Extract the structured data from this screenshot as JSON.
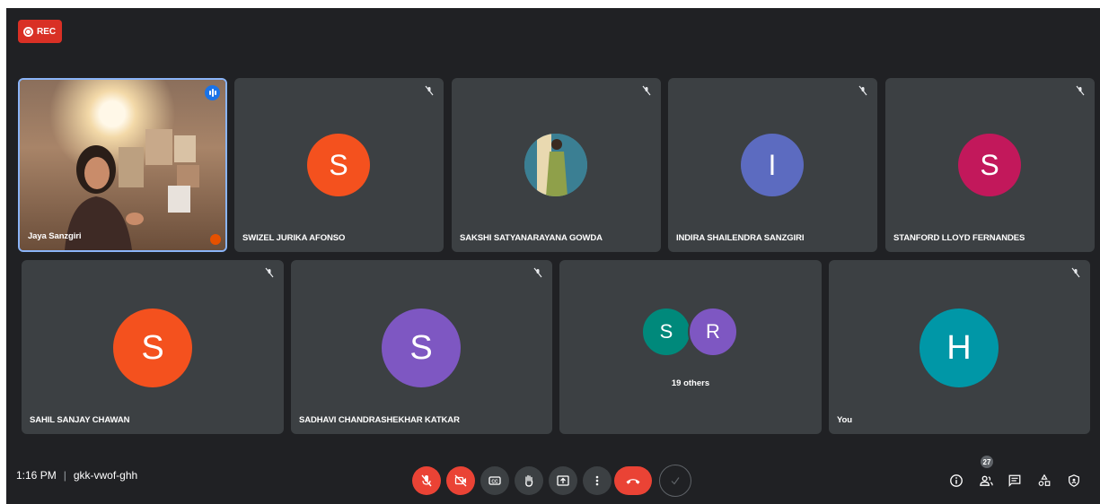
{
  "recording": {
    "label": "REC"
  },
  "tiles_row1": [
    {
      "name": "Jaya Sanzgiri",
      "type": "video"
    },
    {
      "name": "SWIZEL JURIKA AFONSO",
      "initial": "S",
      "color": "#f4511e"
    },
    {
      "name": "SAKSHI SATYANARAYANA GOWDA",
      "type": "photo"
    },
    {
      "name": "INDIRA SHAILENDRA SANZGIRI",
      "initial": "I",
      "color": "#5c6bc0"
    },
    {
      "name": "STANFORD LLOYD FERNANDES",
      "initial": "S",
      "color": "#c2185b"
    }
  ],
  "tiles_row2": [
    {
      "name": "SAHIL SANJAY CHAWAN",
      "initial": "S",
      "color": "#f4511e"
    },
    {
      "name": "SADHAVI CHANDRASHEKHAR KATKAR",
      "initial": "S",
      "color": "#7e57c2"
    },
    {
      "others_label": "19 others",
      "initials": [
        "S",
        "R"
      ],
      "colors": [
        "#00897b",
        "#7e57c2"
      ]
    },
    {
      "name": "You",
      "initial": "H",
      "color": "#0097a7"
    }
  ],
  "footer": {
    "time": "1:16 PM",
    "separator": "|",
    "meeting_code": "gkk-vwof-ghh",
    "participants_count": "27"
  },
  "icons": {
    "mic": "mic-off-icon",
    "camera": "camera-off-icon",
    "captions": "captions-icon",
    "hand": "raise-hand-icon",
    "present": "present-screen-icon",
    "more": "more-options-icon",
    "leave": "leave-call-icon",
    "check": "check-icon",
    "info": "info-icon",
    "people": "people-icon",
    "chat": "chat-icon",
    "activities": "activities-icon",
    "host": "host-controls-icon"
  }
}
